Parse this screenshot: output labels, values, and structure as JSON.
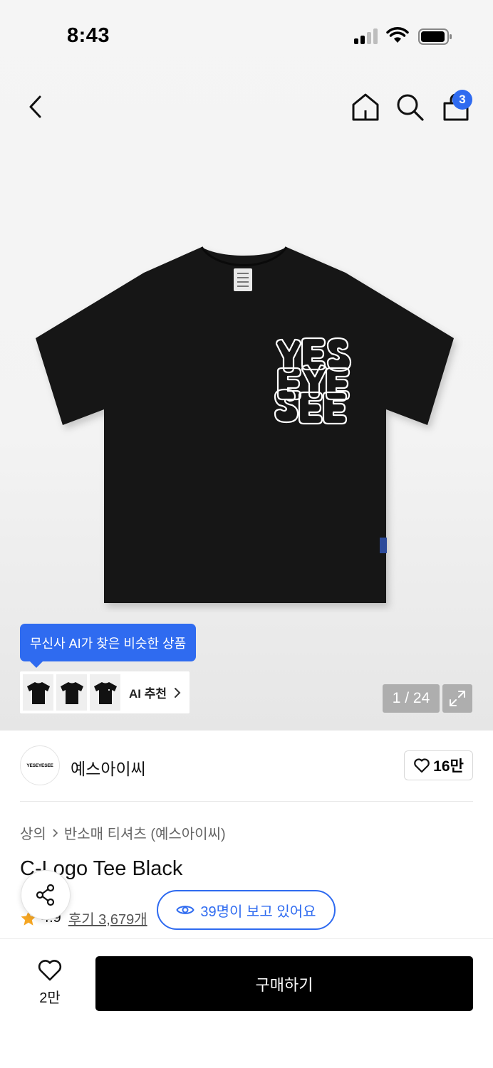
{
  "status_bar": {
    "time": "8:43"
  },
  "nav": {
    "cart_count": "3"
  },
  "ai_recommendation": {
    "tooltip": "무신사 AI가 찾은 비슷한 상품",
    "label": "AI 추천"
  },
  "gallery": {
    "counter": "1 / 24",
    "print_text": "YES EYE SEE"
  },
  "brand": {
    "logo_text": "YESEYESEE",
    "name": "예스아이씨",
    "likes": "16만"
  },
  "breadcrumb": {
    "category": "상의",
    "subcategory": "반소매 티셔츠 (예스아이씨)"
  },
  "product": {
    "title": "C-Logo Tee Black",
    "rating": "4.9",
    "reviews": "후기 3,679개"
  },
  "viewers": {
    "text": "39명이 보고 있어요"
  },
  "bottom": {
    "wish_count": "2만",
    "buy_label": "구매하기"
  },
  "colors": {
    "accent": "#2f6bf0",
    "star": "#f5a623",
    "button": "#000000"
  }
}
